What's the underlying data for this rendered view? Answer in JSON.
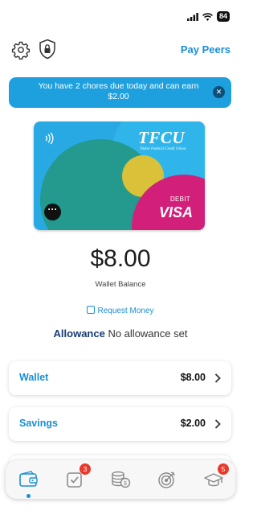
{
  "status_bar": {
    "battery": "84"
  },
  "header": {
    "pay_peers_label": "Pay Peers"
  },
  "banner": {
    "line1": "You have 2 chores due today and can earn",
    "line2": "$2.00",
    "close_icon": "close-icon"
  },
  "card": {
    "issuer": "TFCU",
    "issuer_subtitle": "Tinker Federal Credit Union",
    "type_label": "DEBIT",
    "network": "VISA"
  },
  "wallet_summary": {
    "balance": "$8.00",
    "balance_label": "Wallet Balance",
    "request_money_label": "Request Money"
  },
  "allowance": {
    "label": "Allowance",
    "value": "No allowance set"
  },
  "accounts": [
    {
      "name": "Wallet",
      "amount": "$8.00"
    },
    {
      "name": "Savings",
      "amount": "$2.00"
    }
  ],
  "bottom_nav": {
    "items": [
      {
        "icon": "wallet-icon",
        "badge": ""
      },
      {
        "icon": "chores-check-icon",
        "badge": "3"
      },
      {
        "icon": "coins-icon",
        "badge": ""
      },
      {
        "icon": "goals-target-icon",
        "badge": ""
      },
      {
        "icon": "learn-graduation-cap-icon",
        "badge": "5"
      }
    ]
  },
  "colors": {
    "accent": "#1a8fd6",
    "banner": "#1ea0de",
    "allowance_label": "#163b74",
    "badge": "#e8392d"
  }
}
